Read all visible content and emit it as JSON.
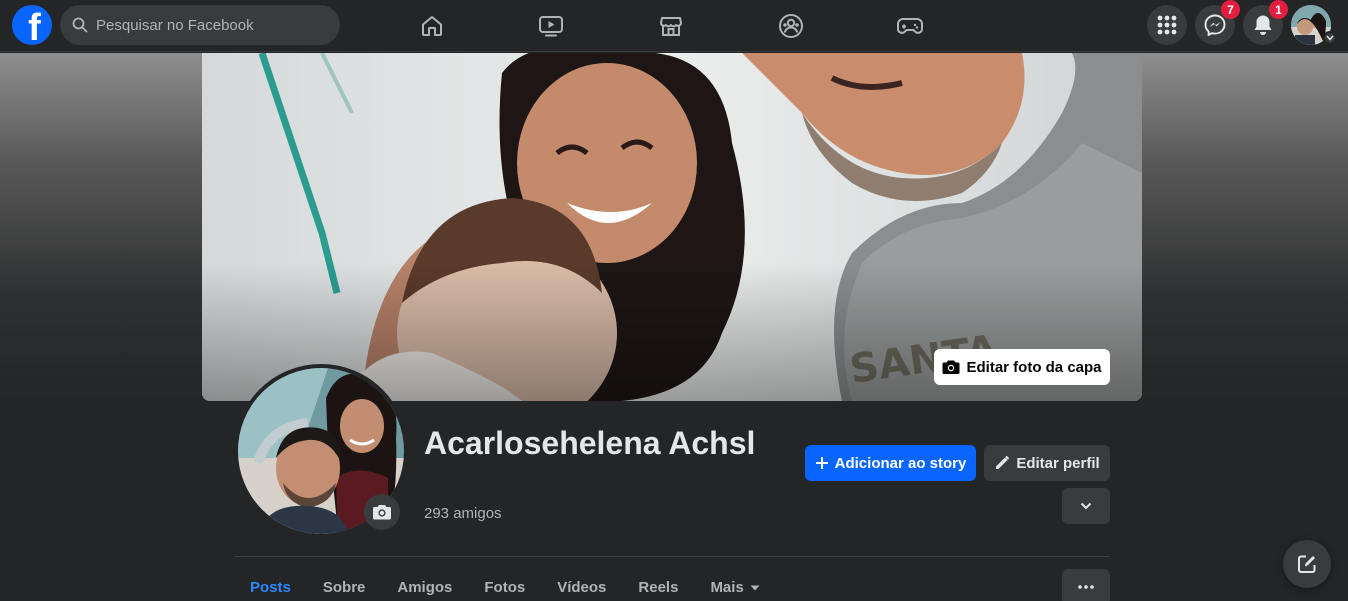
{
  "search": {
    "placeholder": "Pesquisar no Facebook"
  },
  "nav": {
    "items": [
      {
        "icon": "home-icon"
      },
      {
        "icon": "video-icon"
      },
      {
        "icon": "marketplace-icon"
      },
      {
        "icon": "groups-icon"
      },
      {
        "icon": "gaming-icon"
      }
    ]
  },
  "top_right": {
    "menu_icon": "grid-menu-icon",
    "messenger_badge": "7",
    "notifications_badge": "1"
  },
  "cover": {
    "edit_label": "Editar foto da capa"
  },
  "profile": {
    "name": "Acarlosehelena Achsl",
    "friends": "293 amigos"
  },
  "actions": {
    "add_story": "Adicionar ao story",
    "edit_profile": "Editar perfil"
  },
  "tabs": [
    {
      "label": "Posts",
      "active": true
    },
    {
      "label": "Sobre"
    },
    {
      "label": "Amigos"
    },
    {
      "label": "Fotos"
    },
    {
      "label": "Vídeos"
    },
    {
      "label": "Reels"
    },
    {
      "label": "Mais"
    }
  ],
  "colors": {
    "accent": "#0866ff",
    "active_tab": "#2d88ff",
    "badge": "#e41e3f",
    "background": "#242526",
    "surface": "#3a3b3c"
  }
}
